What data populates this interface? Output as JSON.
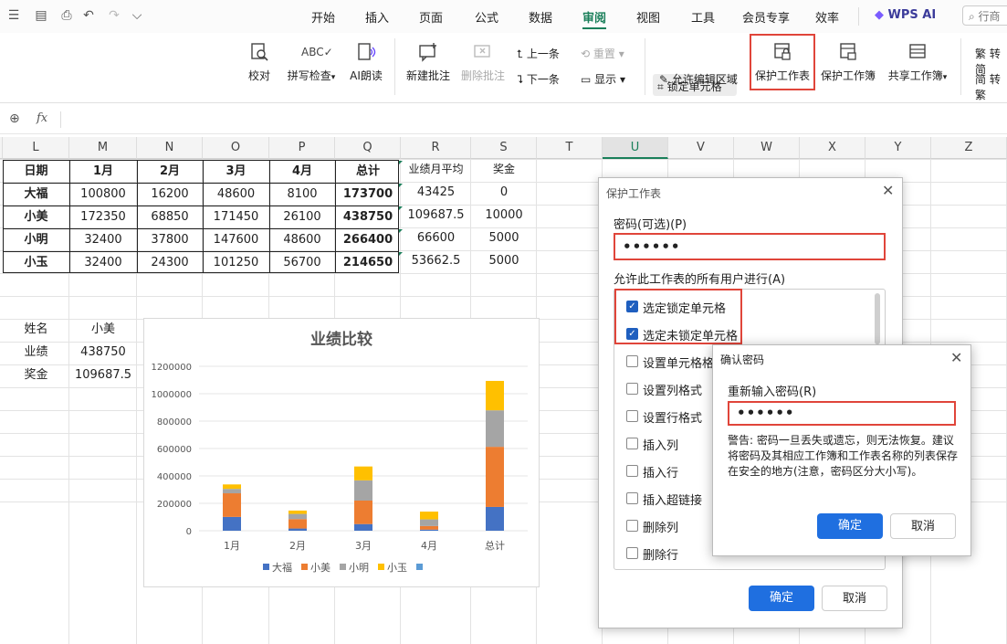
{
  "quick": {
    "dropdown": "⌵"
  },
  "menu": [
    "开始",
    "插入",
    "页面",
    "公式",
    "数据",
    "审阅",
    "视图",
    "工具",
    "会员专享",
    "效率"
  ],
  "menu_active": "审阅",
  "wps_ai": "WPS AI",
  "search_placeholder": "行商",
  "ribbon": {
    "proofread": "校对",
    "spell": "拼写检查",
    "ai_read": "AI朗读",
    "new_comment": "新建批注",
    "del_comment": "删除批注",
    "prev": "上一条",
    "next": "下一条",
    "reset": "重置",
    "show": "显示",
    "lock_cell": "锁定单元格",
    "allow_edit": "允许编辑区域",
    "protect_sheet": "保护工作表",
    "protect_book": "保护工作簿",
    "share_book": "共享工作簿",
    "trad1": "繁 转简",
    "trad2": "简 转繁"
  },
  "formula": {
    "zoom": "⊕",
    "fx": "fx"
  },
  "columns": [
    "L",
    "M",
    "N",
    "O",
    "P",
    "Q",
    "R",
    "S",
    "T",
    "U",
    "V",
    "W",
    "X",
    "Y",
    "Z"
  ],
  "table": {
    "header": [
      "日期",
      "1月",
      "2月",
      "3月",
      "4月",
      "总计"
    ],
    "rows": [
      [
        "大福",
        "100800",
        "16200",
        "48600",
        "8100",
        "173700"
      ],
      [
        "小美",
        "172350",
        "68850",
        "171450",
        "26100",
        "438750"
      ],
      [
        "小明",
        "32400",
        "37800",
        "147600",
        "48600",
        "266400"
      ],
      [
        "小玉",
        "32400",
        "24300",
        "101250",
        "56700",
        "214650"
      ]
    ],
    "extra_header": [
      "业绩月平均",
      "奖金"
    ],
    "extra_rows": [
      [
        "43425",
        "0"
      ],
      [
        "109687.5",
        "10000"
      ],
      [
        "66600",
        "5000"
      ],
      [
        "53662.5",
        "5000"
      ]
    ]
  },
  "lookup": {
    "rows": [
      [
        "姓名",
        "小美"
      ],
      [
        "业绩",
        "438750"
      ],
      [
        "奖金",
        "109687.5"
      ]
    ]
  },
  "chart_data": {
    "type": "bar",
    "stacked": true,
    "title": "业绩比较",
    "categories": [
      "1月",
      "2月",
      "3月",
      "4月",
      "总计"
    ],
    "series": [
      {
        "name": "大福",
        "color": "#4472c4",
        "values": [
          100800,
          16200,
          48600,
          8100,
          173700
        ]
      },
      {
        "name": "小美",
        "color": "#ed7d31",
        "values": [
          172350,
          68850,
          171450,
          26100,
          438750
        ]
      },
      {
        "name": "小明",
        "color": "#a5a5a5",
        "values": [
          32400,
          37800,
          147600,
          48600,
          266400
        ]
      },
      {
        "name": "小玉",
        "color": "#ffc000",
        "values": [
          32400,
          24300,
          101250,
          56700,
          214650
        ]
      },
      {
        "name": "",
        "color": "#5b9bd5",
        "values": [
          0,
          0,
          0,
          0,
          0
        ]
      }
    ],
    "ylim": [
      0,
      1200000
    ],
    "yticks": [
      "0",
      "200000",
      "400000",
      "600000",
      "800000",
      "1000000",
      "1200000"
    ],
    "legend": "bottom"
  },
  "dialog1": {
    "title": "保护工作表",
    "pw_label": "密码(可选)(P)",
    "pw_value": "••••••",
    "allow_label": "允许此工作表的所有用户进行(A)",
    "options": [
      {
        "label": "选定锁定单元格",
        "checked": true
      },
      {
        "label": "选定未锁定单元格",
        "checked": true
      },
      {
        "label": "设置单元格格式",
        "checked": false
      },
      {
        "label": "设置列格式",
        "checked": false
      },
      {
        "label": "设置行格式",
        "checked": false
      },
      {
        "label": "插入列",
        "checked": false
      },
      {
        "label": "插入行",
        "checked": false
      },
      {
        "label": "插入超链接",
        "checked": false
      },
      {
        "label": "删除列",
        "checked": false
      },
      {
        "label": "删除行",
        "checked": false
      }
    ],
    "ok": "确定",
    "cancel": "取消"
  },
  "dialog2": {
    "title": "确认密码",
    "label": "重新输入密码(R)",
    "value": "••••••",
    "warning": "警告: 密码一旦丢失或遗忘，则无法恢复。建议将密码及其相应工作簿和工作表名称的列表保存在安全的地方(注意，密码区分大小写)。",
    "ok": "确定",
    "cancel": "取消"
  }
}
